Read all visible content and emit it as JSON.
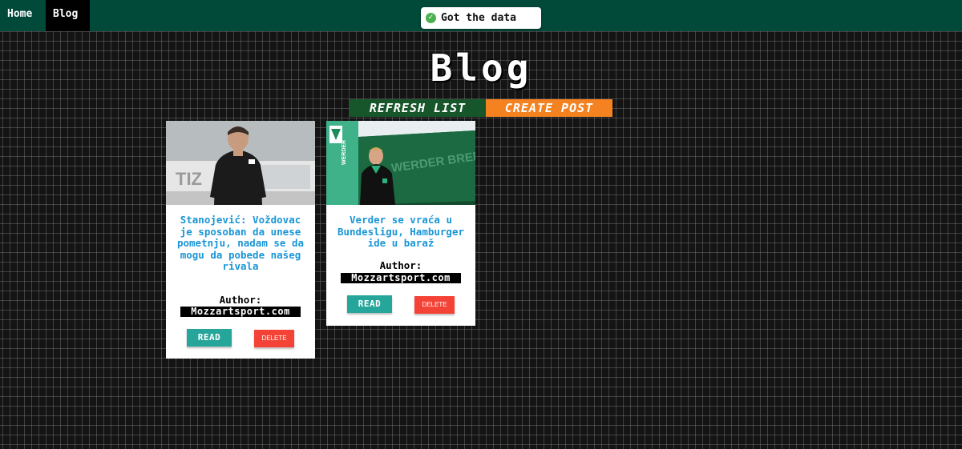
{
  "nav": {
    "home_label": "Home",
    "blog_label": "Blog"
  },
  "toast": {
    "message": "Got the data",
    "icon": "check-circle-icon",
    "color": "#4caf50"
  },
  "page": {
    "title": "Blog"
  },
  "actions": {
    "refresh_label": "REFRESH LIST",
    "create_label": "CREATE POST"
  },
  "posts": [
    {
      "title": "Stanojević: Voždovac je sposoban da unese pometnju, nadam se da mogu da pobede našeg rivala",
      "author_label": "Author:",
      "author": "Mozzartsport.com",
      "read_label": "READ",
      "delete_label": "DELETE"
    },
    {
      "title": "Verder se vraća u Bundesligu, Hamburger ide u baraž",
      "author_label": "Author:",
      "author": "Mozzartsport.com",
      "read_label": "READ",
      "delete_label": "DELETE"
    }
  ],
  "colors": {
    "navbar": "#014a3a",
    "refresh": "#17562a",
    "create": "#f58220",
    "title_text": "#1a96d6",
    "read": "#26a69a",
    "delete": "#f44336"
  }
}
